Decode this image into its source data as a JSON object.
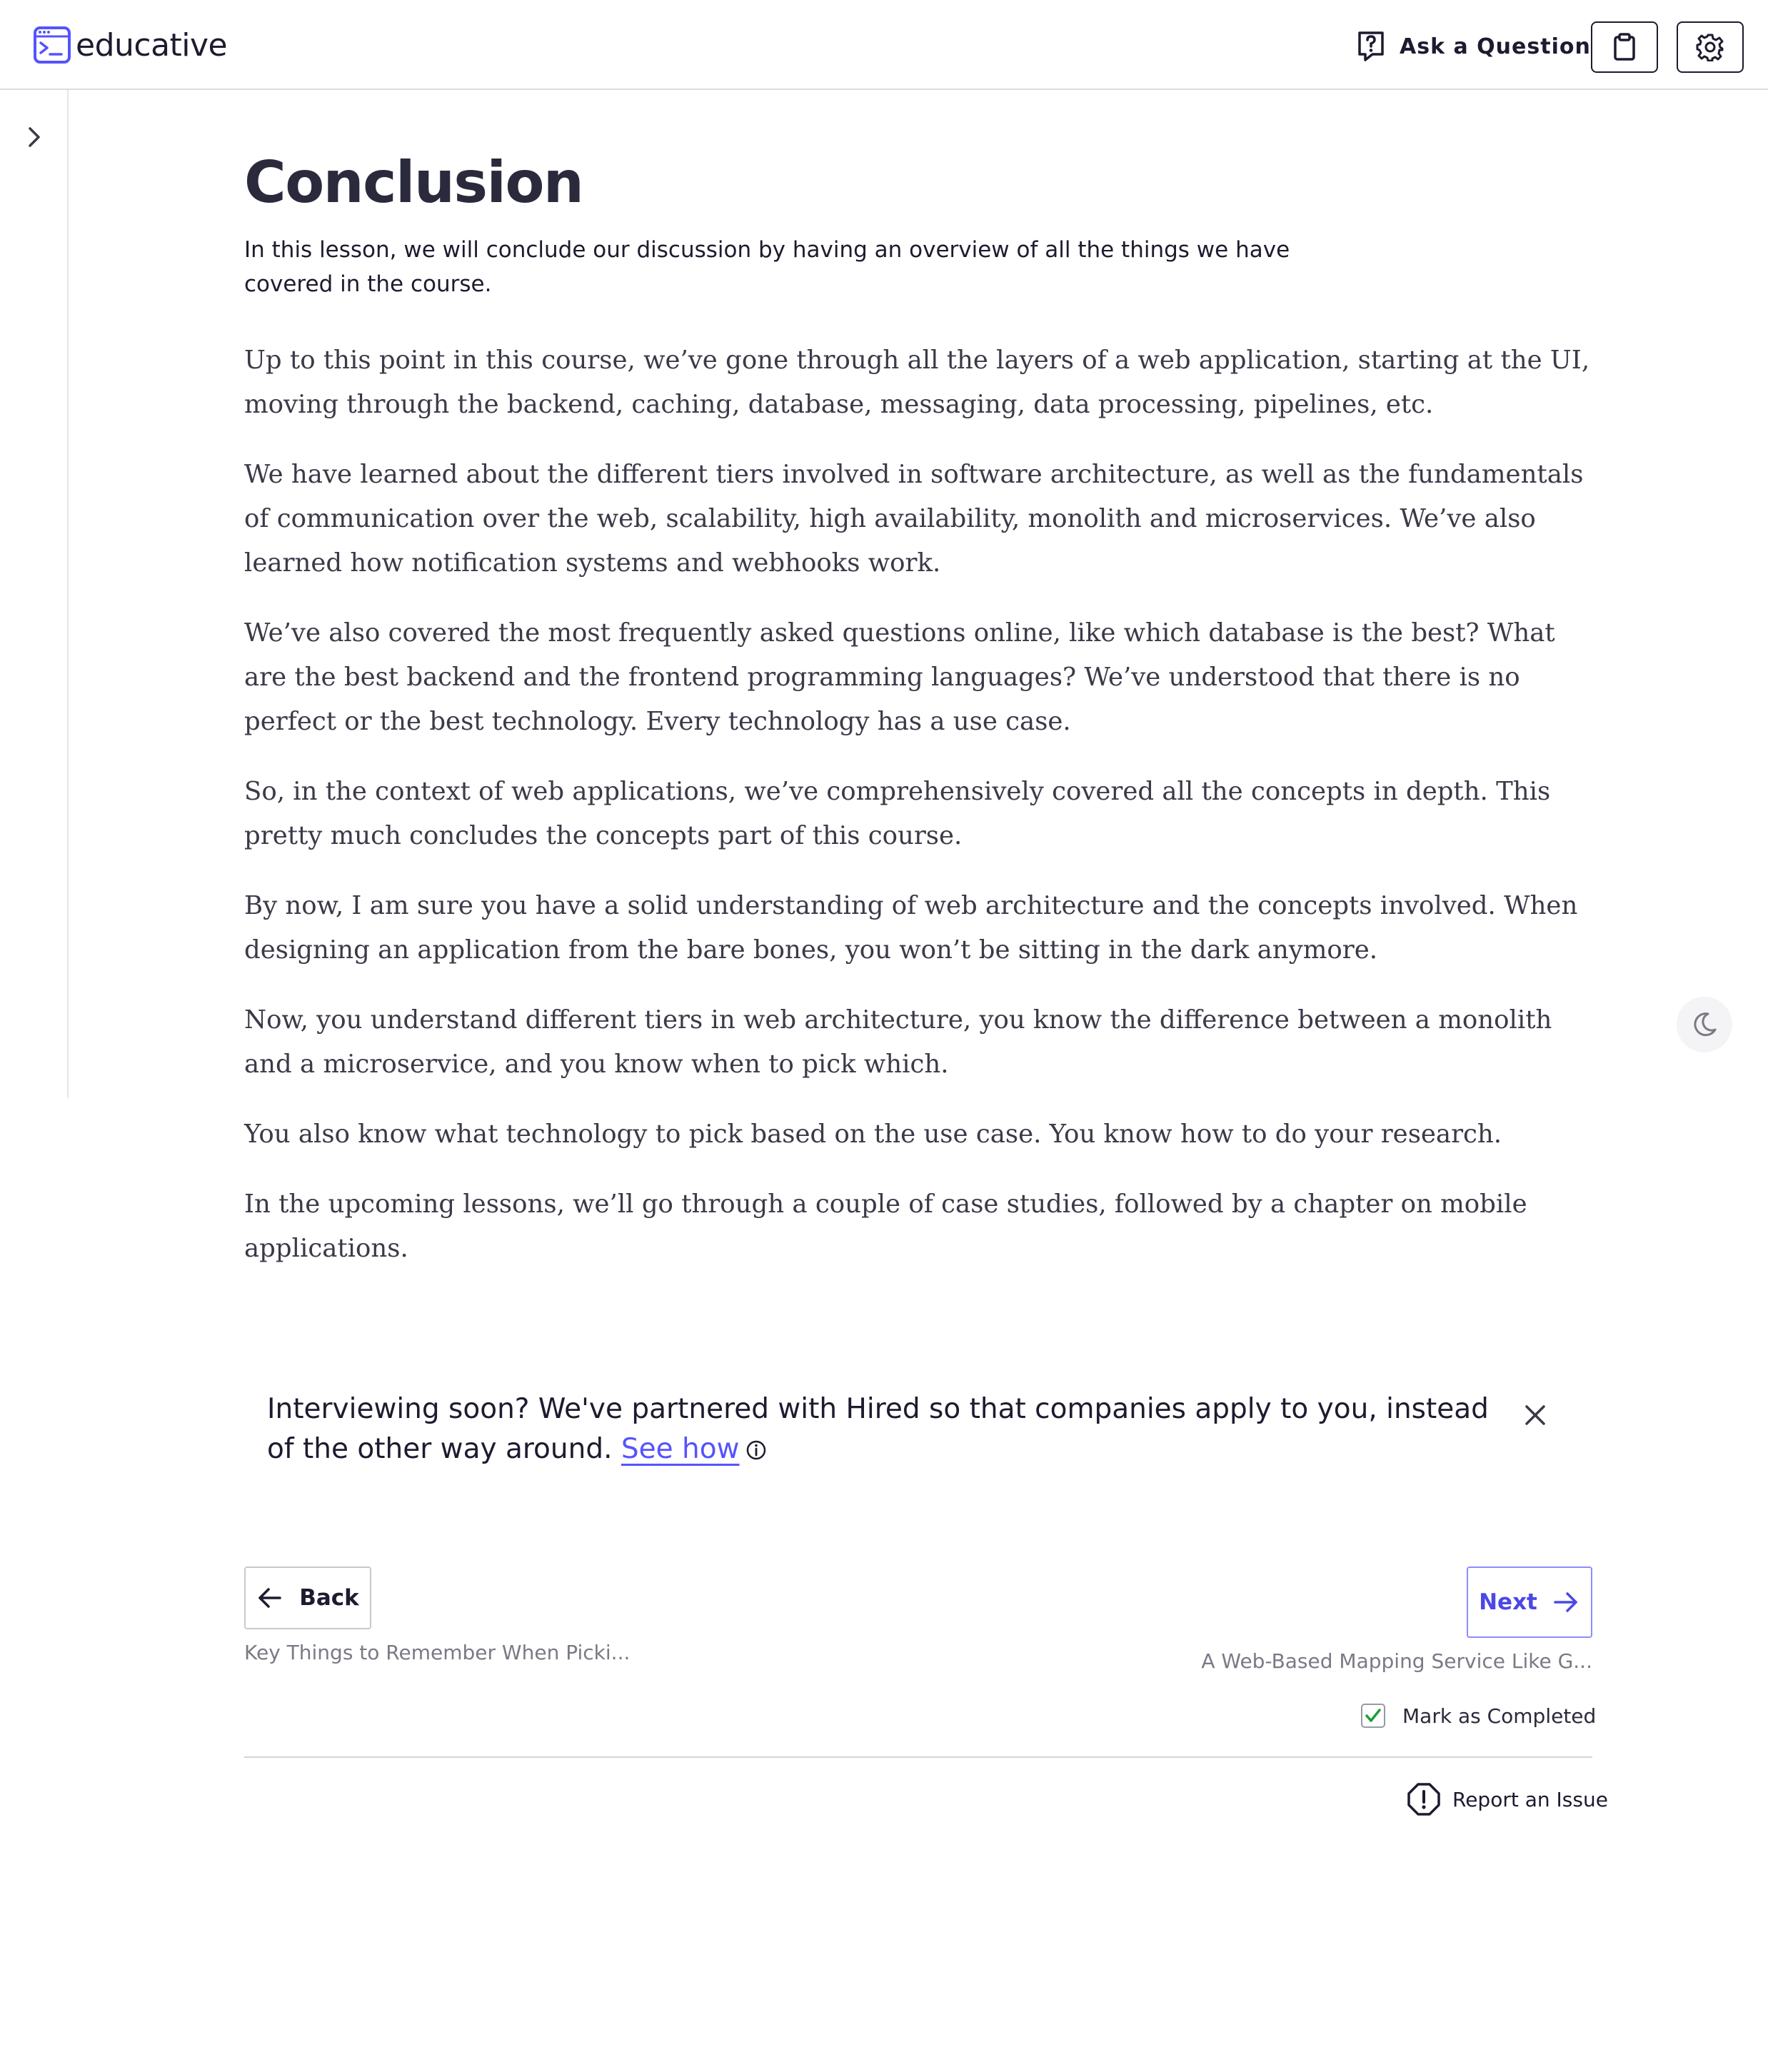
{
  "header": {
    "brand": "educative",
    "ask_label": "Ask a Question"
  },
  "lesson": {
    "title": "Conclusion",
    "summary": "In this lesson, we will conclude our discussion by having an overview of all the things we have covered in the course.",
    "paragraphs": [
      "Up to this point in this course, we’ve gone through all the layers of a web application, starting at the UI, moving through the backend, caching, database, messaging, data processing, pipelines, etc.",
      "We have learned about the different tiers involved in software architecture, as well as the fundamentals of communication over the web, scalability, high availability, monolith and microservices. We’ve also learned how notification systems and webhooks work.",
      "We’ve also covered the most frequently asked questions online, like which database is the best? What are the best backend and the frontend programming languages? We’ve understood that there is no perfect or the best technology. Every technology has a use case.",
      "So, in the context of web applications, we’ve comprehensively covered all the concepts in depth. This pretty much concludes the concepts part of this course.",
      "By now, I am sure you have a solid understanding of web architecture and the concepts involved. When designing an application from the bare bones, you won’t be sitting in the dark anymore.",
      "Now, you understand different tiers in web architecture, you know the difference between a monolith and a microservice, and you know when to pick which.",
      "You also know what technology to pick based on the use case. You know how to do your research.",
      "In the upcoming lessons, we’ll go through a couple of case studies, followed by a chapter on mobile applications."
    ]
  },
  "promo": {
    "text": "Interviewing soon? We've partnered with Hired so that companies apply to you, instead of the other way around.",
    "link": "See how"
  },
  "navigation": {
    "back_label": "Back",
    "back_lesson": "Key Things to Remember When Picki...",
    "next_label": "Next",
    "next_lesson": "A Web-Based Mapping Service Like G...",
    "mark_completed": "Mark as Completed",
    "mark_completed_checked": true,
    "report_issue": "Report an Issue"
  },
  "colors": {
    "brand": "#5553ff",
    "text": "#1d1b2f",
    "body": "#3a3a48",
    "check": "#1f9d3a"
  },
  "icons": [
    "educative-logo-icon",
    "question-icon",
    "clipboard-icon",
    "gear-icon",
    "chevron-right-icon",
    "moon-icon",
    "info-icon",
    "close-icon",
    "arrow-left-icon",
    "arrow-right-icon",
    "check-icon",
    "alert-icon"
  ]
}
